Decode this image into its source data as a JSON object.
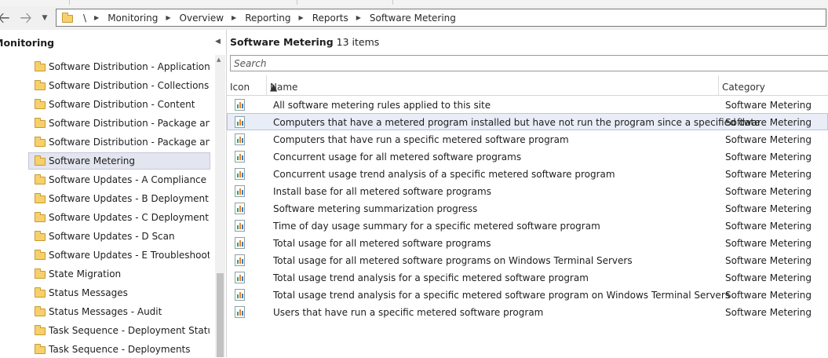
{
  "address_bar": {
    "root": "\\",
    "crumbs": [
      "Monitoring",
      "Overview",
      "Reporting",
      "Reports",
      "Software Metering"
    ]
  },
  "nav": {
    "title": "Monitoring",
    "items": [
      {
        "label": "Software Distribution - Application Mo",
        "selected": false
      },
      {
        "label": "Software Distribution - Collections",
        "selected": false
      },
      {
        "label": "Software Distribution - Content",
        "selected": false
      },
      {
        "label": "Software Distribution - Package and Pr",
        "selected": false
      },
      {
        "label": "Software Distribution - Package and Pr",
        "selected": false
      },
      {
        "label": "Software Metering",
        "selected": true
      },
      {
        "label": "Software Updates - A Compliance",
        "selected": false
      },
      {
        "label": "Software Updates - B Deployment Mar",
        "selected": false
      },
      {
        "label": "Software Updates - C Deployment Stat",
        "selected": false
      },
      {
        "label": "Software Updates - D Scan",
        "selected": false
      },
      {
        "label": "Software Updates - E Troubleshooting",
        "selected": false
      },
      {
        "label": "State Migration",
        "selected": false
      },
      {
        "label": "Status Messages",
        "selected": false
      },
      {
        "label": "Status Messages - Audit",
        "selected": false
      },
      {
        "label": "Task Sequence - Deployment Status",
        "selected": false
      },
      {
        "label": "Task Sequence - Deployments",
        "selected": false
      }
    ]
  },
  "main": {
    "title": "Software Metering",
    "count": "13 items",
    "search_placeholder": "Search",
    "columns": {
      "icon": "Icon",
      "name": "Name",
      "category": "Category"
    },
    "rows": [
      {
        "name": "All software metering rules applied to this site",
        "category": "Software Metering",
        "selected": false
      },
      {
        "name": "Computers that have a metered program installed but have not run the program since a specified date",
        "category": "Software Metering",
        "selected": true
      },
      {
        "name": "Computers that have run a specific metered software program",
        "category": "Software Metering",
        "selected": false
      },
      {
        "name": "Concurrent usage for all metered software programs",
        "category": "Software Metering",
        "selected": false
      },
      {
        "name": "Concurrent usage trend analysis of a specific metered software program",
        "category": "Software Metering",
        "selected": false
      },
      {
        "name": "Install base for all metered software programs",
        "category": "Software Metering",
        "selected": false
      },
      {
        "name": "Software metering summarization progress",
        "category": "Software Metering",
        "selected": false
      },
      {
        "name": "Time of day usage summary for a specific metered software program",
        "category": "Software Metering",
        "selected": false
      },
      {
        "name": "Total usage for all metered software programs",
        "category": "Software Metering",
        "selected": false
      },
      {
        "name": "Total usage for all metered software programs on Windows Terminal Servers",
        "category": "Software Metering",
        "selected": false
      },
      {
        "name": "Total usage trend analysis for a specific metered software program",
        "category": "Software Metering",
        "selected": false
      },
      {
        "name": "Total usage trend analysis for a specific metered software program on Windows Terminal Servers",
        "category": "Software Metering",
        "selected": false
      },
      {
        "name": "Users that have run a specific metered software program",
        "category": "Software Metering",
        "selected": false
      }
    ]
  }
}
